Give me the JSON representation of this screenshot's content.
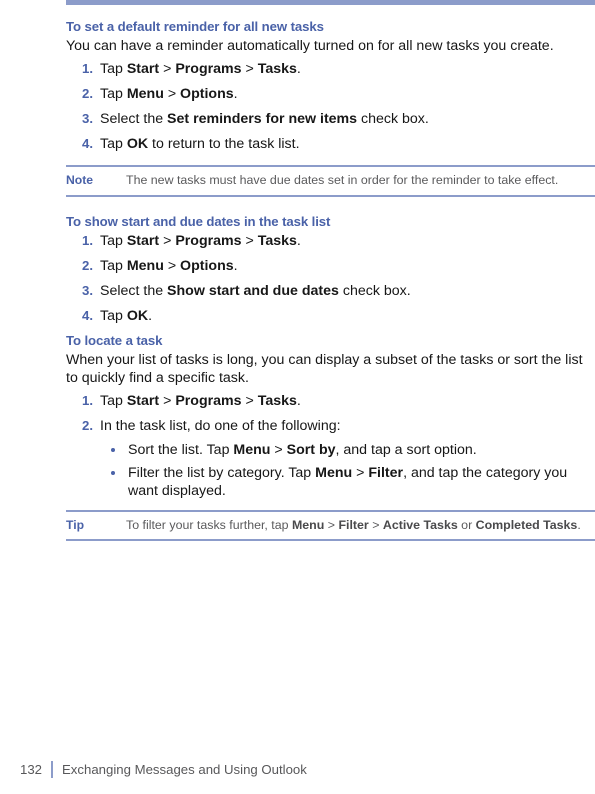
{
  "colors": {
    "accent_blue": "#4a62a8",
    "rule_blue": "#8c9cca",
    "body_text": "#171717",
    "muted_text": "#5a5a5c"
  },
  "sections": [
    {
      "heading": "To set a default reminder for all new tasks",
      "paragraph": "You can have a reminder automatically turned on for all new tasks you create.",
      "steps": [
        {
          "num": "1.",
          "pre": "Tap ",
          "b1": "Start",
          "mid1": " > ",
          "b2": "Programs",
          "mid2": " > ",
          "b3": "Tasks",
          "post": "."
        },
        {
          "num": "2.",
          "pre": "Tap ",
          "b1": "Menu",
          "mid1": " > ",
          "b2": "Options",
          "mid2": "",
          "b3": "",
          "post": "."
        },
        {
          "num": "3.",
          "pre": "Select the ",
          "b1": "Set reminders for new items",
          "mid1": "",
          "b2": "",
          "mid2": "",
          "b3": "",
          "post": " check box."
        },
        {
          "num": "4.",
          "pre": "Tap ",
          "b1": "OK",
          "mid1": "",
          "b2": "",
          "mid2": "",
          "b3": "",
          "post": " to return to the task list."
        }
      ]
    },
    {
      "heading": "To show start and due dates in the task list",
      "steps": [
        {
          "num": "1.",
          "pre": "Tap ",
          "b1": "Start",
          "mid1": " > ",
          "b2": "Programs",
          "mid2": " > ",
          "b3": "Tasks",
          "post": "."
        },
        {
          "num": "2.",
          "pre": "Tap ",
          "b1": "Menu",
          "mid1": " > ",
          "b2": "Options",
          "mid2": "",
          "b3": "",
          "post": "."
        },
        {
          "num": "3.",
          "pre": "Select the ",
          "b1": "Show start and due dates",
          "mid1": "",
          "b2": "",
          "mid2": "",
          "b3": "",
          "post": " check box."
        },
        {
          "num": "4.",
          "pre": "Tap ",
          "b1": "OK",
          "mid1": "",
          "b2": "",
          "mid2": "",
          "b3": "",
          "post": "."
        }
      ]
    }
  ],
  "note": {
    "label": "Note",
    "text": "The new tasks must have due dates set in order for the reminder to take effect."
  },
  "locate": {
    "heading": "To locate a task",
    "paragraph": "When your list of tasks is long, you can display a subset of the tasks or sort the list to quickly find a specific task.",
    "step1": {
      "num": "1.",
      "pre": "Tap ",
      "b1": "Start",
      "mid1": " > ",
      "b2": "Programs",
      "mid2": " > ",
      "b3": "Tasks",
      "post": "."
    },
    "step2": {
      "num": "2.",
      "text": "In the task list, do one of the following:"
    },
    "bullets": [
      {
        "pre": "Sort the list. Tap ",
        "b1": "Menu",
        "mid": " > ",
        "b2": "Sort by",
        "post": ", and tap a sort option."
      },
      {
        "pre": "Filter the list by category. Tap ",
        "b1": "Menu",
        "mid": " > ",
        "b2": "Filter",
        "post": ", and tap the category you want displayed."
      }
    ]
  },
  "tip": {
    "label": "Tip",
    "pre": "To filter your tasks further, tap ",
    "b1": "Menu",
    "mid1": " > ",
    "b2": "Filter",
    "mid2": " > ",
    "b3": "Active Tasks",
    "mid3": " or ",
    "b4": "Completed Tasks",
    "post": "."
  },
  "footer": {
    "page_number": "132",
    "chapter_title": "Exchanging Messages and Using Outlook"
  }
}
